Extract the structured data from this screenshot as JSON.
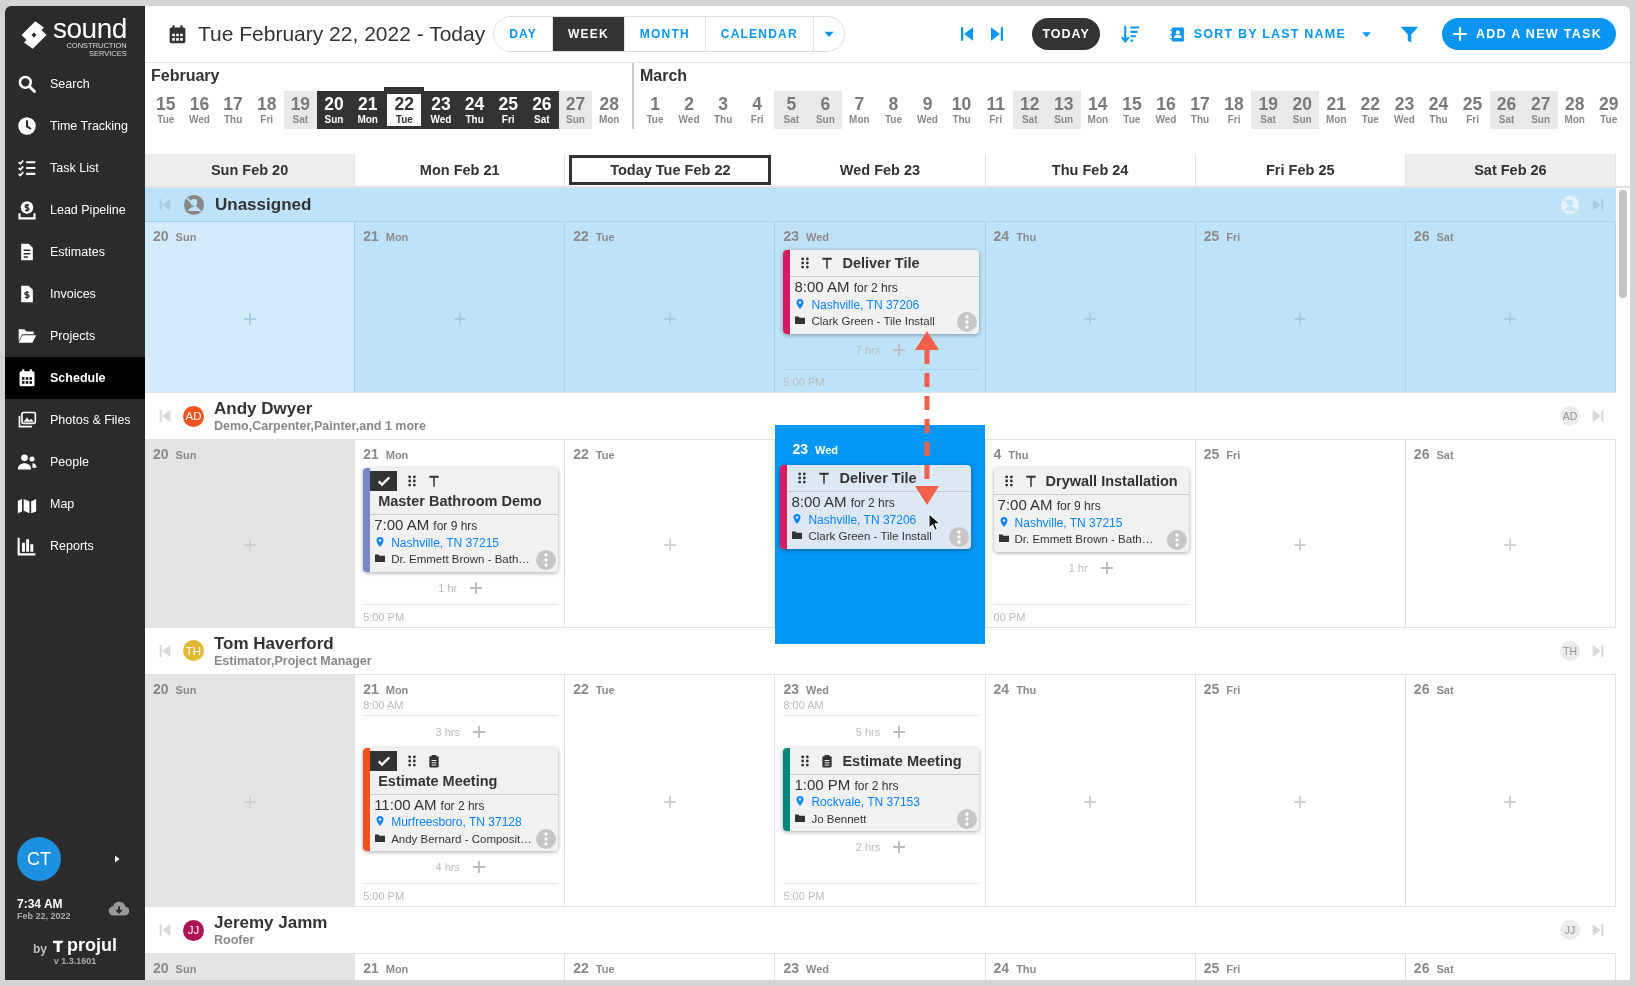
{
  "sidebar": {
    "logo": {
      "name": "sound",
      "tagline": "CONSTRUCTION SERVICES"
    },
    "items": [
      {
        "label": "Search",
        "selected": false
      },
      {
        "label": "Time Tracking",
        "selected": false
      },
      {
        "label": "Task List",
        "selected": false
      },
      {
        "label": "Lead Pipeline",
        "selected": false
      },
      {
        "label": "Estimates",
        "selected": false
      },
      {
        "label": "Invoices",
        "selected": false
      },
      {
        "label": "Projects",
        "selected": false
      },
      {
        "label": "Schedule",
        "selected": true
      },
      {
        "label": "Photos & Files",
        "selected": false
      },
      {
        "label": "People",
        "selected": false
      },
      {
        "label": "Map",
        "selected": false
      },
      {
        "label": "Reports",
        "selected": false
      }
    ],
    "user": {
      "initials": "CT"
    },
    "time": "7:34 AM",
    "date": "Feb 22, 2022",
    "by": "by",
    "brand": "projul",
    "version": "v 1.3.1601"
  },
  "header": {
    "title": "Tue February 22, 2022 - Today",
    "views": [
      {
        "label": "DAY",
        "selected": false
      },
      {
        "label": "WEEK",
        "selected": true
      },
      {
        "label": "MONTH",
        "selected": false
      },
      {
        "label": "CALENDAR",
        "selected": false
      }
    ],
    "today": "TODAY",
    "sort": "SORT BY LAST NAME",
    "add": "ADD A NEW TASK"
  },
  "months": [
    {
      "name": "February",
      "days": [
        {
          "num": "15",
          "dow": "Tue",
          "weekend": false,
          "selected": false,
          "today": false
        },
        {
          "num": "16",
          "dow": "Wed",
          "weekend": false,
          "selected": false,
          "today": false
        },
        {
          "num": "17",
          "dow": "Thu",
          "weekend": false,
          "selected": false,
          "today": false
        },
        {
          "num": "18",
          "dow": "Fri",
          "weekend": false,
          "selected": false,
          "today": false
        },
        {
          "num": "19",
          "dow": "Sat",
          "weekend": true,
          "selected": false,
          "today": false
        },
        {
          "num": "20",
          "dow": "Sun",
          "selected": true,
          "today": false
        },
        {
          "num": "21",
          "dow": "Mon",
          "selected": true,
          "today": false
        },
        {
          "num": "22",
          "dow": "Tue",
          "selected": true,
          "today": true
        },
        {
          "num": "23",
          "dow": "Wed",
          "selected": true,
          "today": false
        },
        {
          "num": "24",
          "dow": "Thu",
          "selected": true,
          "today": false
        },
        {
          "num": "25",
          "dow": "Fri",
          "selected": true,
          "today": false
        },
        {
          "num": "26",
          "dow": "Sat",
          "selected": true,
          "today": false
        },
        {
          "num": "27",
          "dow": "Sun",
          "weekend": true,
          "selected": false,
          "today": false
        },
        {
          "num": "28",
          "dow": "Mon",
          "weekend": false,
          "selected": false,
          "today": false
        }
      ]
    },
    {
      "name": "March",
      "days": [
        {
          "num": "1",
          "dow": "Tue",
          "weekend": false,
          "selected": false,
          "today": false
        },
        {
          "num": "2",
          "dow": "Wed",
          "weekend": false,
          "selected": false,
          "today": false
        },
        {
          "num": "3",
          "dow": "Thu",
          "weekend": false,
          "selected": false,
          "today": false
        },
        {
          "num": "4",
          "dow": "Fri",
          "weekend": false,
          "selected": false,
          "today": false
        },
        {
          "num": "5",
          "dow": "Sat",
          "weekend": true,
          "selected": false,
          "today": false
        },
        {
          "num": "6",
          "dow": "Sun",
          "weekend": true,
          "selected": false,
          "today": false
        },
        {
          "num": "7",
          "dow": "Mon",
          "weekend": false,
          "selected": false,
          "today": false
        },
        {
          "num": "8",
          "dow": "Tue",
          "weekend": false,
          "selected": false,
          "today": false
        },
        {
          "num": "9",
          "dow": "Wed",
          "weekend": false,
          "selected": false,
          "today": false
        },
        {
          "num": "10",
          "dow": "Thu",
          "weekend": false,
          "selected": false,
          "today": false
        },
        {
          "num": "11",
          "dow": "Fri",
          "weekend": false,
          "selected": false,
          "today": false
        },
        {
          "num": "12",
          "dow": "Sat",
          "weekend": true,
          "selected": false,
          "today": false
        },
        {
          "num": "13",
          "dow": "Sun",
          "weekend": true,
          "selected": false,
          "today": false
        },
        {
          "num": "14",
          "dow": "Mon",
          "weekend": false,
          "selected": false,
          "today": false
        },
        {
          "num": "15",
          "dow": "Tue",
          "weekend": false,
          "selected": false,
          "today": false
        },
        {
          "num": "16",
          "dow": "Wed",
          "weekend": false,
          "selected": false,
          "today": false
        },
        {
          "num": "17",
          "dow": "Thu",
          "weekend": false,
          "selected": false,
          "today": false
        },
        {
          "num": "18",
          "dow": "Fri",
          "weekend": false,
          "selected": false,
          "today": false
        },
        {
          "num": "19",
          "dow": "Sat",
          "weekend": true,
          "selected": false,
          "today": false
        },
        {
          "num": "20",
          "dow": "Sun",
          "weekend": true,
          "selected": false,
          "today": false
        },
        {
          "num": "21",
          "dow": "Mon",
          "weekend": false,
          "selected": false,
          "today": false
        },
        {
          "num": "22",
          "dow": "Tue",
          "weekend": false,
          "selected": false,
          "today": false
        },
        {
          "num": "23",
          "dow": "Wed",
          "weekend": false,
          "selected": false,
          "today": false
        },
        {
          "num": "24",
          "dow": "Thu",
          "weekend": false,
          "selected": false,
          "today": false
        },
        {
          "num": "25",
          "dow": "Fri",
          "weekend": false,
          "selected": false,
          "today": false
        },
        {
          "num": "26",
          "dow": "Sat",
          "weekend": true,
          "selected": false,
          "today": false
        },
        {
          "num": "27",
          "dow": "Sun",
          "weekend": true,
          "selected": false,
          "today": false
        },
        {
          "num": "28",
          "dow": "Mon",
          "weekend": false,
          "selected": false,
          "today": false
        },
        {
          "num": "29",
          "dow": "Tue",
          "weekend": false,
          "selected": false,
          "today": false
        }
      ]
    }
  ],
  "week_columns": [
    {
      "label": "Sun Feb 20",
      "weekend": true,
      "today": false
    },
    {
      "label": "Mon Feb 21",
      "weekend": false,
      "today": false
    },
    {
      "label": "Today Tue Feb 22",
      "weekend": false,
      "today": true
    },
    {
      "label": "Wed Feb 23",
      "weekend": false,
      "today": false
    },
    {
      "label": "Thu Feb 24",
      "weekend": false,
      "today": false
    },
    {
      "label": "Fri Feb 25",
      "weekend": false,
      "today": false
    },
    {
      "label": "Sat Feb 26",
      "weekend": true,
      "today": false
    }
  ],
  "groups": [
    {
      "kind": "unassigned",
      "name": "Unassigned",
      "days": [
        {
          "kind": "day",
          "num": "20",
          "dow": "Sun",
          "shaded": true
        },
        {
          "kind": "day",
          "num": "21",
          "dow": "Mon",
          "shaded": false
        },
        {
          "kind": "day",
          "num": "22",
          "dow": "Tue",
          "shaded": false
        },
        {
          "kind": "day",
          "num": "23",
          "dow": "Wed",
          "shaded": false,
          "entries": [
            {
              "kind": "job",
              "title": "Deliver Tile",
              "time": "8:00 AM",
              "duration": "for 2 hrs",
              "location": "Nashville, TN 37206",
              "project": "Clark Green - Tile Install",
              "color": "#d81b60",
              "checked": false
            },
            {
              "kind": "gap",
              "label": "7 hrs"
            }
          ],
          "end": "5:00 PM"
        },
        {
          "kind": "day",
          "num": "24",
          "dow": "Thu",
          "shaded": false
        },
        {
          "kind": "day",
          "num": "25",
          "dow": "Fri",
          "shaded": false
        },
        {
          "kind": "day",
          "num": "26",
          "dow": "Sat",
          "shaded": false
        }
      ]
    },
    {
      "kind": "person",
      "name": "Andy Dwyer",
      "initials": "AD",
      "faded_initials": "AD",
      "color": "#f4511e",
      "roles": "Demo,Carpenter,Painter,and 1 more",
      "days": [
        {
          "kind": "day",
          "num": "20",
          "dow": "Sun",
          "shaded": true
        },
        {
          "kind": "day",
          "num": "21",
          "dow": "Mon",
          "shaded": false,
          "entries": [
            {
              "kind": "job",
              "title": "Master Bathroom Demo",
              "time": "7:00 AM",
              "duration": "for 9 hrs",
              "location": "Nashville, TN 37215",
              "project": "Dr. Emmett Brown - Bath…",
              "color": "#7986cb",
              "checked": true
            },
            {
              "kind": "gap",
              "label": "1 hr"
            }
          ],
          "end": "5:00 PM"
        },
        {
          "kind": "day",
          "num": "22",
          "dow": "Tue",
          "shaded": false
        },
        {
          "kind": "drop-target",
          "num": "23",
          "dow": "Wed",
          "entries": [
            {
              "kind": "job",
              "title": "Deliver Tile",
              "time": "8:00 AM",
              "duration": "for 2 hrs",
              "location": "Nashville, TN 37206",
              "project": "Clark Green - Tile Install",
              "color": "#d81b60",
              "checked": false
            }
          ]
        },
        {
          "kind": "day",
          "num": "4",
          "dow": "Thu",
          "shaded": false,
          "entries": [
            {
              "kind": "job",
              "title": "Drywall Installation",
              "time": "7:00 AM",
              "duration": "for 9 hrs",
              "location": "Nashville, TN 37215",
              "project": "Dr. Emmett Brown - Bath…",
              "checked": false
            },
            {
              "kind": "gap",
              "label": "1 hr"
            }
          ],
          "end": "00 PM"
        },
        {
          "kind": "day",
          "num": "25",
          "dow": "Fri",
          "shaded": false
        },
        {
          "kind": "day",
          "num": "26",
          "dow": "Sat",
          "shaded": false
        }
      ]
    },
    {
      "kind": "person",
      "name": "Tom Haverford",
      "initials": "TH",
      "faded_initials": "TH",
      "color": "#e2b935",
      "roles": "Estimator,Project Manager",
      "days": [
        {
          "kind": "day",
          "num": "20",
          "dow": "Sun",
          "shaded": true
        },
        {
          "kind": "day",
          "num": "21",
          "dow": "Mon",
          "shaded": false,
          "start": "8:00 AM",
          "entries": [
            {
              "kind": "gap",
              "label": "3 hrs"
            },
            {
              "kind": "estimate",
              "title": "Estimate Meeting",
              "time": "11:00 AM",
              "duration": "for 2 hrs",
              "location": "Murfreesboro, TN 37128",
              "project": "Andy Bernard - Composit…",
              "color": "#f4511e",
              "checked": true
            },
            {
              "kind": "gap",
              "label": "4 hrs"
            }
          ],
          "end": "5:00 PM"
        },
        {
          "kind": "day",
          "num": "22",
          "dow": "Tue",
          "shaded": false
        },
        {
          "kind": "day",
          "num": "23",
          "dow": "Wed",
          "shaded": false,
          "start": "8:00 AM",
          "entries": [
            {
              "kind": "gap",
              "label": "5 hrs"
            },
            {
              "kind": "estimate",
              "title": "Estimate Meeting",
              "time": "1:00 PM",
              "duration": "for 2 hrs",
              "location": "Rockvale, TN 37153",
              "project": "Jo Bennett",
              "color": "#00897b",
              "checked": false
            },
            {
              "kind": "gap",
              "label": "2 hrs"
            }
          ],
          "end": "5:00 PM"
        },
        {
          "kind": "day",
          "num": "24",
          "dow": "Thu",
          "shaded": false
        },
        {
          "kind": "day",
          "num": "25",
          "dow": "Fri",
          "shaded": false
        },
        {
          "kind": "day",
          "num": "26",
          "dow": "Sat",
          "shaded": false
        }
      ]
    },
    {
      "kind": "person",
      "name": "Jeremy Jamm",
      "initials": "JJ",
      "faded_initials": "JJ",
      "color": "#ad1457",
      "roles": "Roofer",
      "days": [
        {
          "kind": "day",
          "num": "20",
          "dow": "Sun",
          "shaded": true
        },
        {
          "kind": "day",
          "num": "21",
          "dow": "Mon",
          "shaded": false
        },
        {
          "kind": "day",
          "num": "22",
          "dow": "Tue",
          "shaded": false
        },
        {
          "kind": "day",
          "num": "23",
          "dow": "Wed",
          "shaded": false
        },
        {
          "kind": "day",
          "num": "24",
          "dow": "Thu",
          "shaded": false
        },
        {
          "kind": "day",
          "num": "25",
          "dow": "Fri",
          "shaded": false
        },
        {
          "kind": "day",
          "num": "26",
          "dow": "Sat",
          "shaded": false
        }
      ]
    }
  ]
}
